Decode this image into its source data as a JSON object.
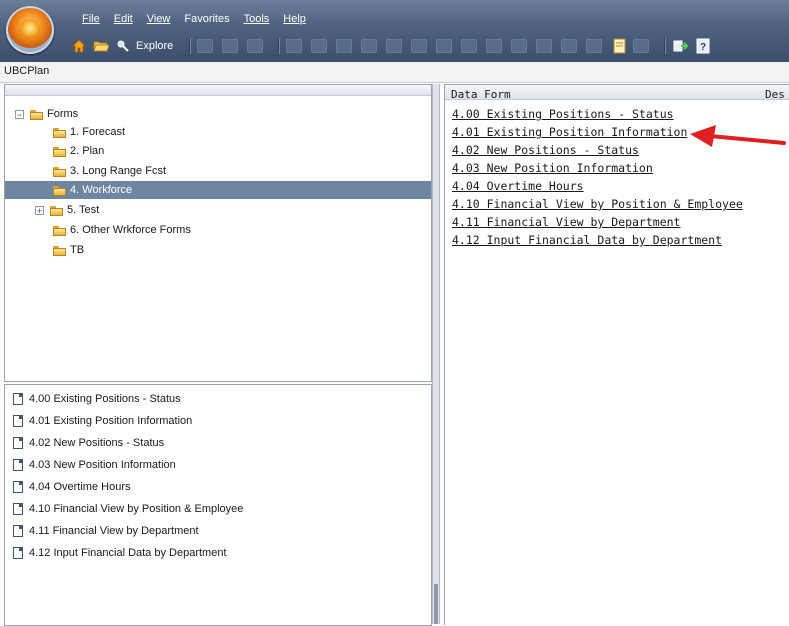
{
  "menu": [
    {
      "label": "File",
      "acc_index": 0
    },
    {
      "label": "Edit",
      "acc_index": 0
    },
    {
      "label": "View",
      "acc_index": 0
    },
    {
      "label": "Favorites",
      "acc_index": 4
    },
    {
      "label": "Tools",
      "acc_index": 0
    },
    {
      "label": "Help",
      "acc_index": 0
    }
  ],
  "toolbar": {
    "explore_label": "Explore"
  },
  "breadcrumb": {
    "app_name": "UBCPlan"
  },
  "tree": {
    "root_label": "Forms",
    "items": [
      {
        "label": "1. Forecast"
      },
      {
        "label": "2. Plan"
      },
      {
        "label": "3. Long Range Fcst"
      },
      {
        "label": "4. Workforce",
        "selected": true
      },
      {
        "label": "5. Test",
        "expandable": true
      },
      {
        "label": "6. Other Wrkforce Forms"
      },
      {
        "label": "TB"
      }
    ]
  },
  "form_list": [
    "4.00 Existing Positions - Status",
    "4.01 Existing Position Information",
    "4.02 New Positions - Status",
    "4.03 New Position Information",
    "4.04 Overtime Hours",
    "4.10 Financial View by Position & Employee",
    "4.11 Financial View by Department",
    "4.12 Input Financial Data by Department"
  ],
  "right_pane": {
    "columns": [
      "Data Form",
      "Des"
    ],
    "links": [
      "4.00 Existing Positions - Status",
      "4.01 Existing Position Information",
      "4.02 New Positions - Status",
      "4.03 New Position Information",
      "4.04 Overtime Hours",
      "4.10 Financial View by Position & Employee",
      "4.11 Financial View by Department",
      "4.12 Input Financial Data by Department"
    ]
  },
  "colors": {
    "chrome_bg": "#4f6381",
    "selection": "#6f86a3",
    "annotation_arrow": "#e02020"
  },
  "icons": [
    "app-orb-icon",
    "home-icon",
    "open-folder-icon",
    "explore-icon",
    "logout-icon",
    "help-icon",
    "folder-icon",
    "document-icon",
    "expand-icon",
    "collapse-icon"
  ]
}
